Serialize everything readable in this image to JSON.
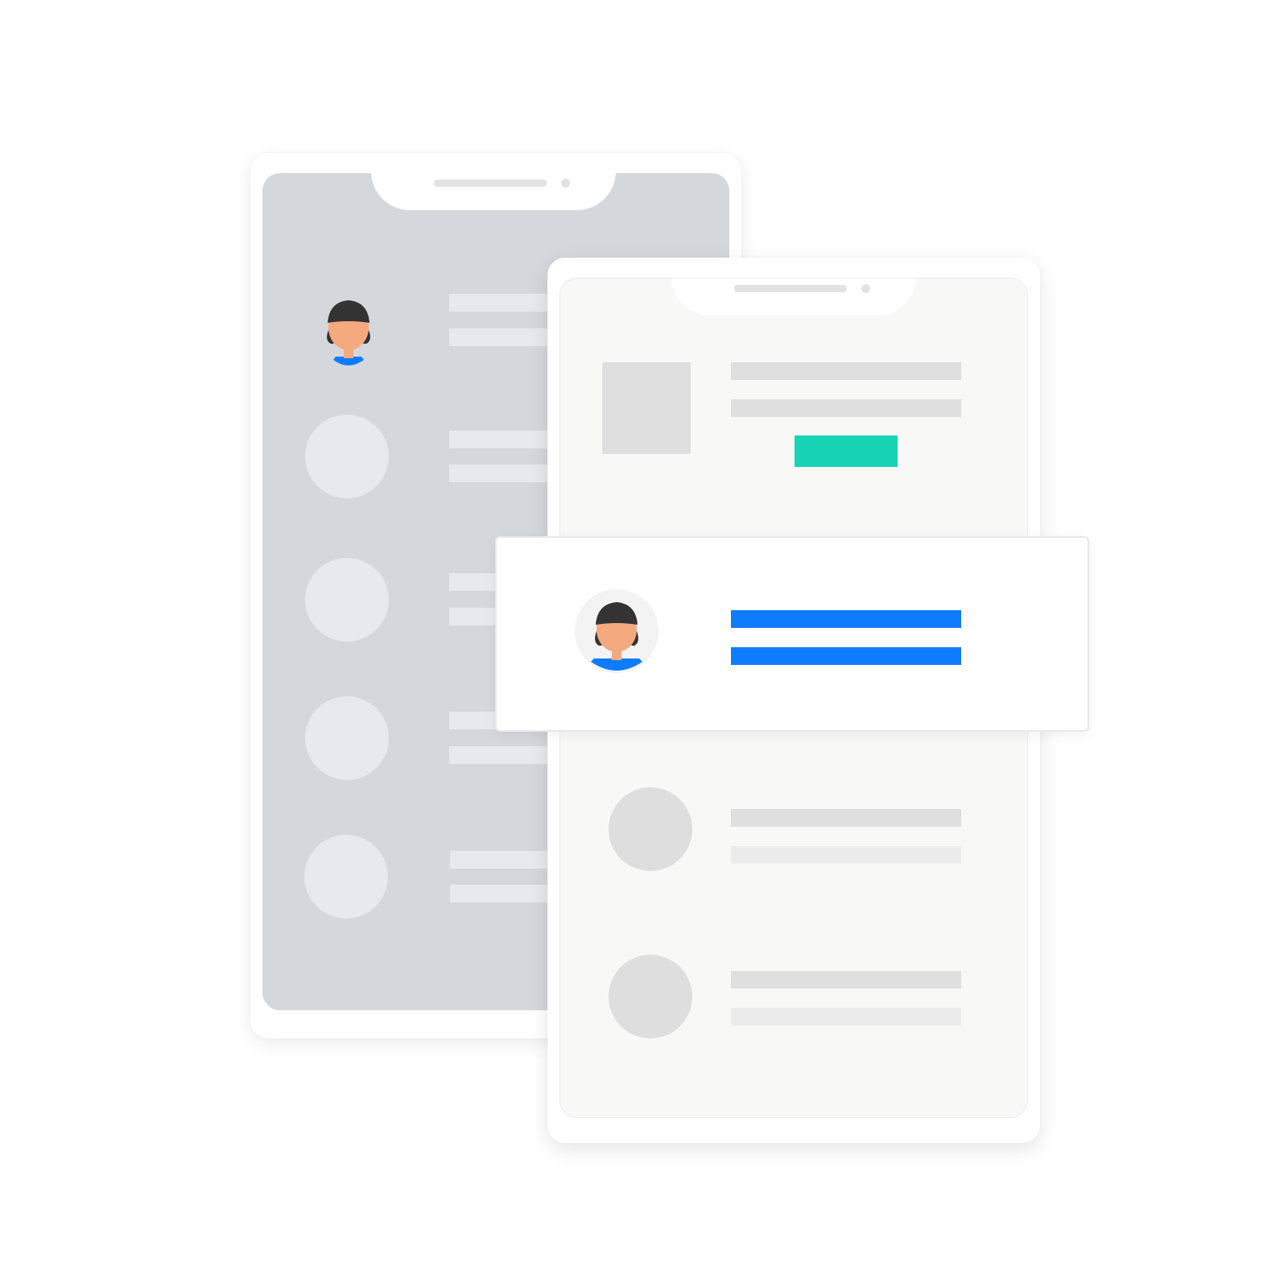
{
  "colors": {
    "accent_blue": "#0f7cff",
    "cta_teal": "#17d4b4",
    "back_screen": "#d4d8dd",
    "front_screen": "#f8f8f7",
    "placeholder_light": "#e6e9ee",
    "placeholder_gray": "#dedede",
    "skin": "#f4a97f",
    "hair": "#333333"
  },
  "icons": {
    "avatar": "person-avatar-icon",
    "speaker": "speaker-slot",
    "camera": "camera-dot"
  },
  "back_phone": {
    "list_items": 5,
    "first_item_has_avatar": true
  },
  "front_phone": {
    "hero_has_button": true,
    "list_items": 2
  },
  "highlight_card": {
    "has_avatar": true,
    "lines": 2
  }
}
